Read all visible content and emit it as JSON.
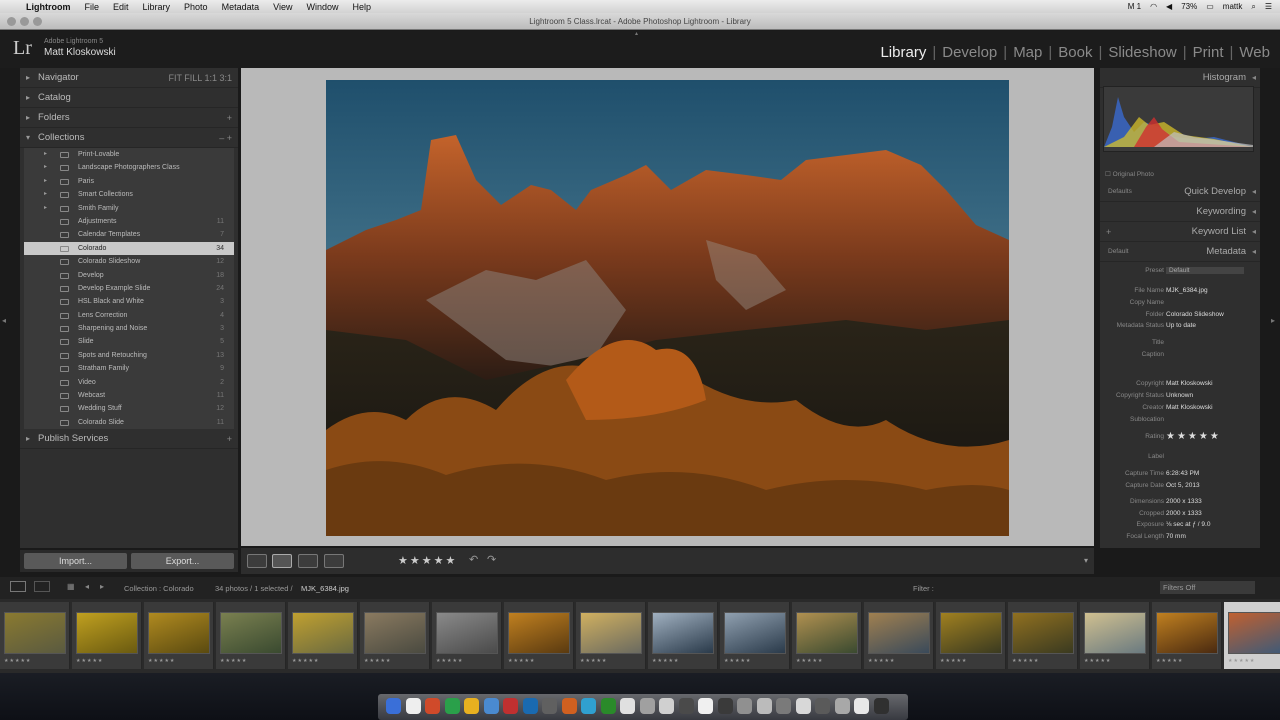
{
  "menubar": {
    "apple": "",
    "app": "Lightroom",
    "items": [
      "File",
      "Edit",
      "Library",
      "Photo",
      "Metadata",
      "View",
      "Window",
      "Help"
    ],
    "status": {
      "battery": "73%",
      "user": "mattk",
      "m": "M 1"
    }
  },
  "window": {
    "title": "Lightroom 5 Class.lrcat - Adobe Photoshop Lightroom - Library"
  },
  "identity": {
    "logo": "Lr",
    "app_line": "Adobe Lightroom 5",
    "user": "Matt Kloskowski"
  },
  "modules": [
    "Library",
    "Develop",
    "Map",
    "Book",
    "Slideshow",
    "Print",
    "Web"
  ],
  "active_module": "Library",
  "left_panels": {
    "navigator": "Navigator",
    "navigator_zoom": "FIT  FILL  1:1  3:1",
    "catalog": "Catalog",
    "folders": "Folders",
    "collections": "Collections",
    "publish": "Publish Services"
  },
  "collections": [
    {
      "name": "Print-Lovable",
      "count": ""
    },
    {
      "name": "Landscape Photographers Class",
      "count": ""
    },
    {
      "name": "Paris",
      "count": ""
    },
    {
      "name": "Smart Collections",
      "count": ""
    },
    {
      "name": "Smith Family",
      "count": ""
    },
    {
      "name": "Adjustments",
      "count": "11"
    },
    {
      "name": "Calendar Templates",
      "count": "7"
    },
    {
      "name": "Colorado",
      "count": "34"
    },
    {
      "name": "Colorado Slideshow",
      "count": "12"
    },
    {
      "name": "Develop",
      "count": "18"
    },
    {
      "name": "Develop Example Slide",
      "count": "24"
    },
    {
      "name": "HSL Black and White",
      "count": "3"
    },
    {
      "name": "Lens Correction",
      "count": "4"
    },
    {
      "name": "Sharpening and Noise",
      "count": "3"
    },
    {
      "name": "Slide",
      "count": "5"
    },
    {
      "name": "Spots and Retouching",
      "count": "13"
    },
    {
      "name": "Stratham Family",
      "count": "9"
    },
    {
      "name": "Video",
      "count": "2"
    },
    {
      "name": "Webcast",
      "count": "11"
    },
    {
      "name": "Wedding Stuff",
      "count": "12"
    },
    {
      "name": "Colorado Slide",
      "count": "11"
    }
  ],
  "import_label": "Import...",
  "export_label": "Export...",
  "rating_stars": "★★★★★",
  "right_panels": {
    "histogram": "Histogram",
    "original_photo": "Original Photo",
    "quick_develop": "Quick Develop",
    "keywording": "Keywording",
    "keyword_list": "Keyword List",
    "metadata": "Metadata",
    "defaults": "Defaults",
    "default": "Default",
    "preset_label": "Preset",
    "preset_value": "Default"
  },
  "metadata": [
    {
      "k": "File Name",
      "v": "MJK_6384.jpg"
    },
    {
      "k": "Copy Name",
      "v": ""
    },
    {
      "k": "Folder",
      "v": "Colorado Slideshow"
    },
    {
      "k": "Metadata Status",
      "v": "Up to date"
    },
    {
      "k": "Title",
      "v": ""
    },
    {
      "k": "Caption",
      "v": ""
    },
    {
      "k": "Copyright",
      "v": "Matt Kloskowski"
    },
    {
      "k": "Copyright Status",
      "v": "Unknown"
    },
    {
      "k": "Creator",
      "v": "Matt Kloskowski"
    },
    {
      "k": "Sublocation",
      "v": ""
    },
    {
      "k": "Rating",
      "v": ""
    },
    {
      "k": "Label",
      "v": ""
    },
    {
      "k": "Capture Time",
      "v": "6:28:43 PM"
    },
    {
      "k": "Capture Date",
      "v": "Oct 5, 2013"
    },
    {
      "k": "Dimensions",
      "v": "2000 x 1333"
    },
    {
      "k": "Cropped",
      "v": "2000 x 1333"
    },
    {
      "k": "Exposure",
      "v": "⅛ sec at ƒ / 9.0"
    },
    {
      "k": "Focal Length",
      "v": "70 mm"
    }
  ],
  "filmstrip_bar": {
    "source": "Collection : Colorado",
    "status": "34 photos / 1 selected /",
    "filename": "MJK_6384.jpg",
    "filter": "Filter :",
    "filters_off": "Filters Off"
  },
  "thumbs": [
    {
      "colors": [
        "#5a5a40",
        "#8a7a30"
      ]
    },
    {
      "colors": [
        "#6a5a10",
        "#c0a020"
      ]
    },
    {
      "colors": [
        "#5a4a10",
        "#b08a20"
      ]
    },
    {
      "colors": [
        "#3a4a30",
        "#7a8050"
      ]
    },
    {
      "colors": [
        "#6a6a40",
        "#c0a030"
      ]
    },
    {
      "colors": [
        "#4a4a40",
        "#8a7a60"
      ]
    },
    {
      "colors": [
        "#4a4a4a",
        "#8a8a8a"
      ]
    },
    {
      "colors": [
        "#5a3a10",
        "#c08020"
      ]
    },
    {
      "colors": [
        "#6a6a60",
        "#d0b060"
      ]
    },
    {
      "colors": [
        "#2a3a4a",
        "#a0b0c0"
      ]
    },
    {
      "colors": [
        "#2a3a4a",
        "#90a0b0"
      ]
    },
    {
      "colors": [
        "#3a4a30",
        "#b09050"
      ]
    },
    {
      "colors": [
        "#3a4a5a",
        "#a08050"
      ]
    },
    {
      "colors": [
        "#3a3a20",
        "#a08020"
      ]
    },
    {
      "colors": [
        "#3a3a20",
        "#907020"
      ]
    },
    {
      "colors": [
        "#6a7a80",
        "#d0c090"
      ]
    },
    {
      "colors": [
        "#4a2a10",
        "#c08020"
      ]
    },
    {
      "colors": [
        "#3a5a7a",
        "#c06030"
      ]
    }
  ],
  "colors": {
    "panel": "#2f2f2f",
    "selection": "#c9c9c9",
    "accent_sky": "#2d5a77"
  }
}
